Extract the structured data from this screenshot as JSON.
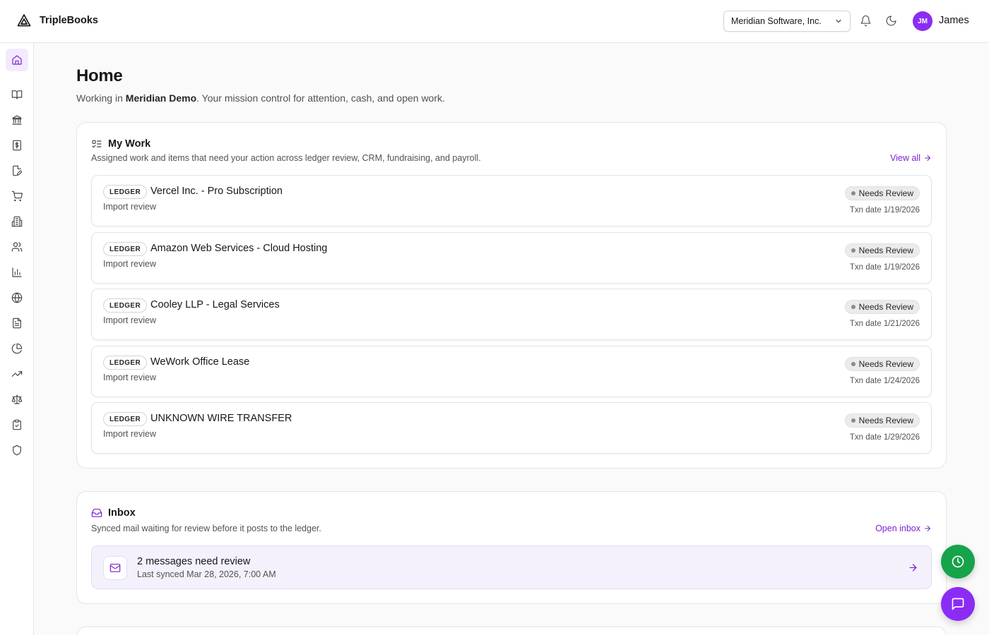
{
  "app": {
    "brand_name": "TripleBooks",
    "brand_icon": "triangle-logo-icon"
  },
  "header": {
    "org_selector": "Meridian Software, Inc.",
    "user_initials": "JM",
    "user_name": "James",
    "avatar_color": "#8b2cf5"
  },
  "sidebar": {
    "items": [
      {
        "name": "home",
        "icon": "home-icon",
        "active": true
      },
      {
        "name": "book",
        "icon": "book-icon",
        "active": false
      },
      {
        "name": "banking",
        "icon": "bank-icon",
        "active": false
      },
      {
        "name": "invoices",
        "icon": "dollar-receipt-icon",
        "active": false
      },
      {
        "name": "notes",
        "icon": "edit-document-icon",
        "active": false
      },
      {
        "name": "purchases",
        "icon": "cart-icon",
        "active": false
      },
      {
        "name": "organization",
        "icon": "building-icon",
        "active": false
      },
      {
        "name": "contacts",
        "icon": "users-icon",
        "active": false
      },
      {
        "name": "reports",
        "icon": "bar-chart-icon",
        "active": false
      },
      {
        "name": "global",
        "icon": "globe-icon",
        "active": false
      },
      {
        "name": "documents",
        "icon": "file-text-icon",
        "active": false
      },
      {
        "name": "analytics",
        "icon": "pie-chart-icon",
        "active": false
      },
      {
        "name": "trends",
        "icon": "trending-up-icon",
        "active": false
      },
      {
        "name": "compliance",
        "icon": "scale-icon",
        "active": false
      },
      {
        "name": "tasks",
        "icon": "clipboard-check-icon",
        "active": false
      },
      {
        "name": "security",
        "icon": "shield-icon",
        "active": false
      }
    ]
  },
  "page": {
    "title": "Home",
    "subtitle_prefix": "Working in ",
    "subtitle_bold": "Meridian Demo",
    "subtitle_suffix": ". Your mission control for attention, cash, and open work."
  },
  "my_work": {
    "title": "My Work",
    "description": "Assigned work and items that need your action across ledger review, CRM, fundraising, and payroll.",
    "link": "View all",
    "items": [
      {
        "badge": "LEDGER",
        "title": "Vercel Inc. - Pro Subscription",
        "subtitle": "Import review",
        "status": "Needs Review",
        "date": "Txn date 1/19/2026"
      },
      {
        "badge": "LEDGER",
        "title": "Amazon Web Services - Cloud Hosting",
        "subtitle": "Import review",
        "status": "Needs Review",
        "date": "Txn date 1/19/2026"
      },
      {
        "badge": "LEDGER",
        "title": "Cooley LLP - Legal Services",
        "subtitle": "Import review",
        "status": "Needs Review",
        "date": "Txn date 1/21/2026"
      },
      {
        "badge": "LEDGER",
        "title": "WeWork Office Lease",
        "subtitle": "Import review",
        "status": "Needs Review",
        "date": "Txn date 1/24/2026"
      },
      {
        "badge": "LEDGER",
        "title": "UNKNOWN WIRE TRANSFER",
        "subtitle": "Import review",
        "status": "Needs Review",
        "date": "Txn date 1/29/2026"
      }
    ]
  },
  "inbox": {
    "title": "Inbox",
    "description": "Synced mail waiting for review before it posts to the ledger.",
    "link": "Open inbox",
    "row_title": "2 messages need review",
    "row_subtitle": "Last synced Mar 28, 2026, 7:00 AM"
  },
  "fabs": {
    "history_color": "#16a34a",
    "chat_color": "#8b2cf5"
  },
  "colors": {
    "accent": "#7e22ce",
    "active_nav_bg": "#f1ebfd"
  }
}
